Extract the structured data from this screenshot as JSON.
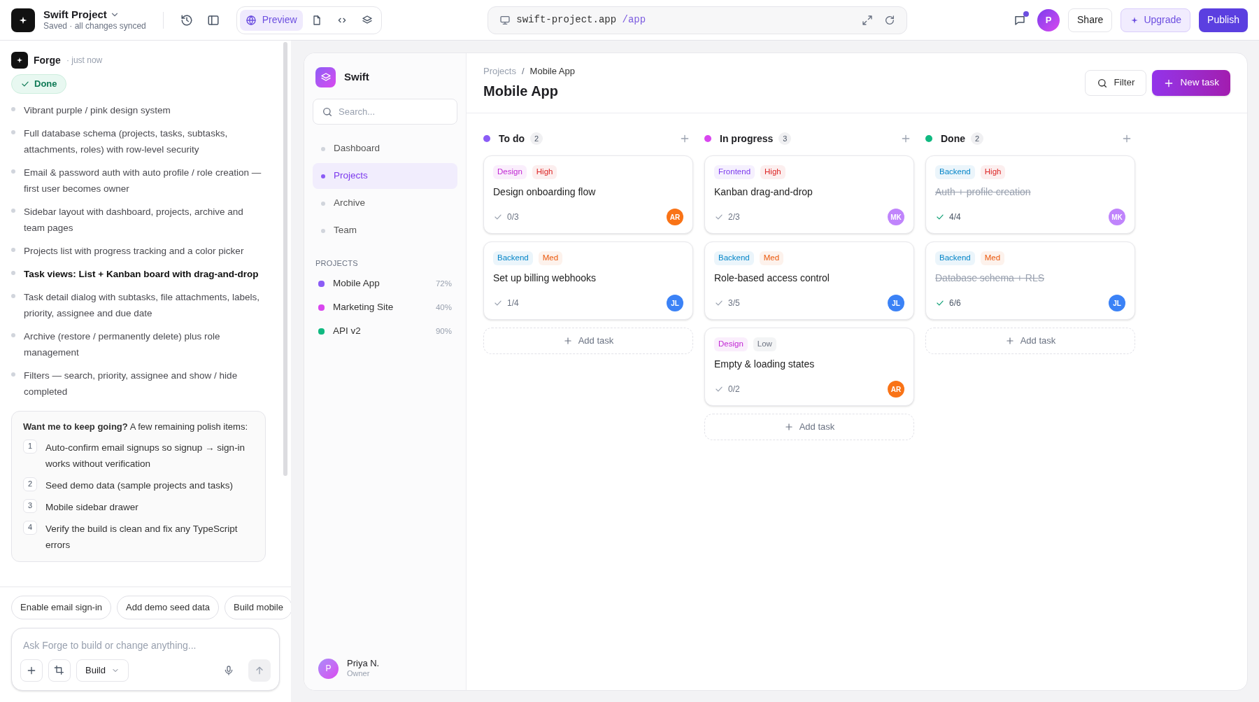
{
  "topbar": {
    "project": "Swift Project",
    "status": "Saved · all changes synced",
    "view_tabs": [
      {
        "kind": "preview",
        "label": "Preview",
        "selected": true
      },
      {
        "kind": "file",
        "selected": false
      },
      {
        "kind": "code",
        "selected": false
      },
      {
        "kind": "layers",
        "selected": false
      }
    ],
    "url": {
      "host": "swift-project.app",
      "path": "/app"
    },
    "notification": true,
    "avatar": "P",
    "buttons": [
      {
        "kind": "share",
        "label": "Share"
      },
      {
        "kind": "upgrade",
        "label": "Upgrade"
      },
      {
        "kind": "publish",
        "label": "Publish"
      }
    ]
  },
  "chat": {
    "author": "Forge",
    "time": "· just now",
    "badge": "Done",
    "items": [
      {
        "text": "Vibrant purple / pink design system",
        "emphasized": false
      },
      {
        "text": "Full database schema (projects, tasks, subtasks, attachments, roles) with row-level security",
        "emphasized": false
      },
      {
        "text": "Email & password auth with auto profile / role creation — first user becomes owner",
        "emphasized": false
      },
      {
        "text": "Sidebar layout with dashboard, projects, archive and team pages",
        "emphasized": false
      },
      {
        "text": "Projects list with progress tracking and a color picker",
        "emphasized": false
      },
      {
        "text": "Task views: List + Kanban board with drag-and-drop",
        "emphasized": true
      },
      {
        "text": "Task detail dialog with subtasks, file attachments, labels, priority, assignee and due date",
        "emphasized": false
      },
      {
        "text": "Archive (restore / permanently delete) plus role management",
        "emphasized": false
      },
      {
        "text": "Filters — search, priority, assignee and show / hide completed",
        "emphasized": false
      }
    ],
    "followup": {
      "text": "**Want me to keep going?** A few remaining polish items:",
      "steps": [
        {
          "number": "1",
          "text": "Auto-confirm email signups so signup → sign-in works without verification"
        },
        {
          "number": "2",
          "text": "Seed demo data (sample projects and tasks)"
        },
        {
          "number": "3",
          "text": "Mobile sidebar drawer"
        },
        {
          "number": "4",
          "text": "Verify the build is clean and fix any TypeScript errors"
        }
      ]
    },
    "suggestions": [
      "Enable email sign-in",
      "Add demo seed data",
      "Build mobile"
    ],
    "input": {
      "placeholder": "Ask Forge to build or change anything...",
      "mode": "Build"
    }
  },
  "app": {
    "brand": "Swift",
    "search": {
      "placeholder": "Search..."
    },
    "nav": [
      {
        "label": "Dashboard",
        "selected": false
      },
      {
        "label": "Projects",
        "selected": true
      },
      {
        "label": "Archive",
        "selected": false
      },
      {
        "label": "Team",
        "selected": false
      }
    ],
    "projects_heading": "PROJECTS",
    "projects": [
      {
        "name": "Mobile App",
        "percent": "72%",
        "color": "#8b5cf6"
      },
      {
        "name": "Marketing Site",
        "percent": "40%",
        "color": "#d946ef"
      },
      {
        "name": "API v2",
        "percent": "90%",
        "color": "#10b981"
      }
    ],
    "user": {
      "initial": "P",
      "name": "Priya N.",
      "role": "Owner"
    },
    "breadcrumb": [
      "Projects",
      "Mobile App"
    ],
    "breadcrumb_separator": "/",
    "title": "Mobile App",
    "filter": "Filter",
    "new_task": "New task",
    "columns": [
      {
        "title": "To do",
        "count": "2",
        "color": "#8b5cf6",
        "add": "Add task",
        "tasks": [
          {
            "tags": [
              {
                "label": "Design",
                "color": "#c026d3"
              },
              {
                "label": "High",
                "color": "#dc2626"
              }
            ],
            "title": "Design onboarding flow",
            "progress": "0/3",
            "done": false,
            "assignee": {
              "initials": "AR",
              "color": "#f97316"
            }
          },
          {
            "tags": [
              {
                "label": "Backend",
                "color": "#0284c7"
              },
              {
                "label": "Med",
                "color": "#ea580c"
              }
            ],
            "title": "Set up billing webhooks",
            "progress": "1/4",
            "done": false,
            "assignee": {
              "initials": "JL",
              "color": "#3b82f6"
            }
          }
        ]
      },
      {
        "title": "In progress",
        "count": "3",
        "color": "#d946ef",
        "add": "Add task",
        "tasks": [
          {
            "tags": [
              {
                "label": "Frontend",
                "color": "#7c3aed"
              },
              {
                "label": "High",
                "color": "#dc2626"
              }
            ],
            "title": "Kanban drag-and-drop",
            "progress": "2/3",
            "done": false,
            "assignee": {
              "initials": "MK",
              "color": "#c084fc"
            }
          },
          {
            "tags": [
              {
                "label": "Backend",
                "color": "#0284c7"
              },
              {
                "label": "Med",
                "color": "#ea580c"
              }
            ],
            "title": "Role-based access control",
            "progress": "3/5",
            "done": false,
            "assignee": {
              "initials": "JL",
              "color": "#3b82f6"
            }
          },
          {
            "tags": [
              {
                "label": "Design",
                "color": "#c026d3"
              },
              {
                "label": "Low",
                "color": "#6b7280"
              }
            ],
            "title": "Empty & loading states",
            "progress": "0/2",
            "done": false,
            "assignee": {
              "initials": "AR",
              "color": "#f97316"
            }
          }
        ]
      },
      {
        "title": "Done",
        "count": "2",
        "color": "#10b981",
        "add": "Add task",
        "tasks": [
          {
            "tags": [
              {
                "label": "Backend",
                "color": "#0284c7"
              },
              {
                "label": "High",
                "color": "#dc2626"
              }
            ],
            "title": "Auth + profile creation",
            "progress": "4/4",
            "done": true,
            "assignee": {
              "initials": "MK",
              "color": "#c084fc"
            }
          },
          {
            "tags": [
              {
                "label": "Backend",
                "color": "#0284c7"
              },
              {
                "label": "Med",
                "color": "#ea580c"
              }
            ],
            "title": "Database schema + RLS",
            "progress": "6/6",
            "done": true,
            "assignee": {
              "initials": "JL",
              "color": "#3b82f6"
            }
          }
        ]
      }
    ]
  }
}
